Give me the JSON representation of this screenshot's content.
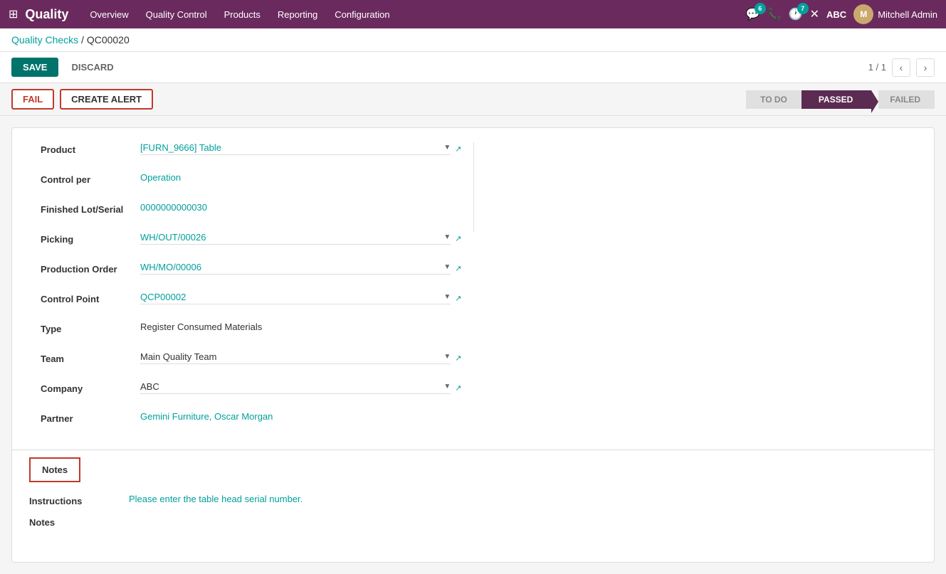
{
  "app": {
    "name": "Quality",
    "nav_items": [
      "Overview",
      "Quality Control",
      "Products",
      "Reporting",
      "Configuration"
    ]
  },
  "topbar": {
    "notification_count": "6",
    "phone_icon": "☎",
    "timer_count": "7",
    "close_icon": "✕",
    "user_initials": "ABC",
    "user_name": "Mitchell Admin"
  },
  "breadcrumb": {
    "parent": "Quality Checks",
    "separator": "/",
    "current": "QC00020"
  },
  "toolbar": {
    "save_label": "SAVE",
    "discard_label": "DISCARD",
    "pager": "1 / 1"
  },
  "actions": {
    "fail_label": "FAIL",
    "create_alert_label": "CREATE ALERT"
  },
  "status": {
    "todo": "TO DO",
    "passed": "PASSED",
    "failed": "FAILED"
  },
  "form": {
    "left": {
      "product_label": "Product",
      "product_value": "[FURN_9666] Table",
      "control_per_label": "Control per",
      "control_per_value": "Operation",
      "finished_lot_label": "Finished Lot/Serial",
      "finished_lot_value": "0000000000030"
    },
    "right": {
      "picking_label": "Picking",
      "picking_value": "WH/OUT/00026",
      "production_order_label": "Production Order",
      "production_order_value": "WH/MO/00006",
      "control_point_label": "Control Point",
      "control_point_value": "QCP00002",
      "type_label": "Type",
      "type_value": "Register Consumed Materials",
      "team_label": "Team",
      "team_value": "Main Quality Team",
      "company_label": "Company",
      "company_value": "ABC",
      "partner_label": "Partner",
      "partner_value": "Gemini Furniture, Oscar Morgan"
    }
  },
  "notes": {
    "tab_label": "Notes",
    "instructions_label": "Instructions",
    "instructions_value": "Please enter the table head serial number.",
    "notes_label": "Notes"
  }
}
